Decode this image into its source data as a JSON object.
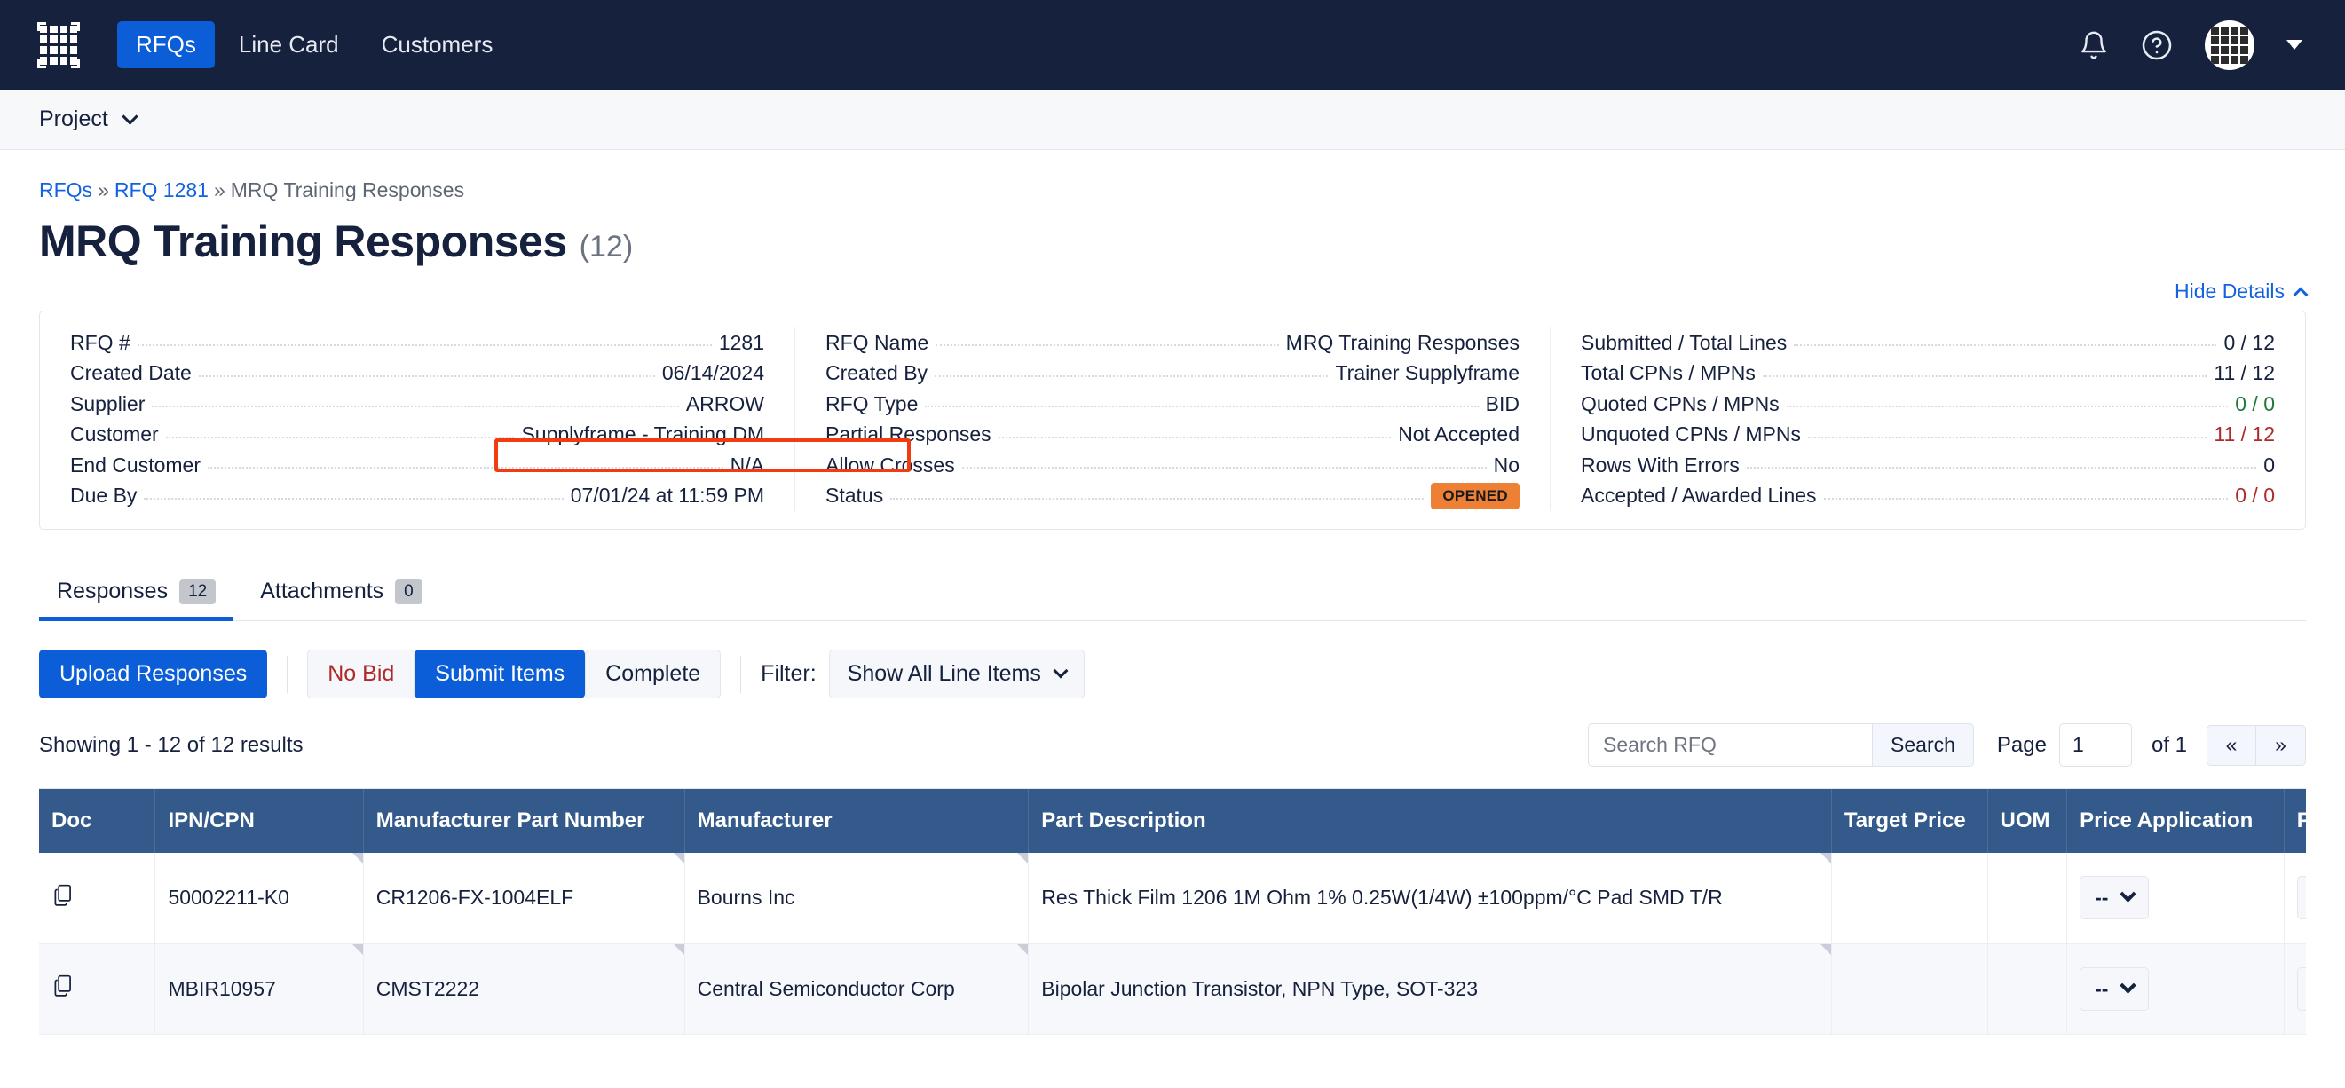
{
  "topnav": {
    "logo_icon": "grid-logo-icon",
    "items": [
      {
        "label": "RFQs",
        "active": true
      },
      {
        "label": "Line Card",
        "active": false
      },
      {
        "label": "Customers",
        "active": false
      }
    ],
    "right_icons": [
      "bell-icon",
      "help-circle-icon",
      "avatar",
      "chevron-down-icon"
    ],
    "accent_color": "#0b5ed7",
    "background_color": "#16213e"
  },
  "projectbar": {
    "label": "Project",
    "chevron": "chevron-down-icon"
  },
  "breadcrumb": {
    "item1": "RFQs",
    "sep1": "»",
    "item2": "RFQ 1281",
    "sep2": "»",
    "item3": "MRQ Training Responses"
  },
  "page_header": {
    "title": "MRQ Training Responses",
    "count": "(12)",
    "hide_details": "Hide Details"
  },
  "details": {
    "col1": [
      {
        "key": "RFQ #",
        "value": "1281"
      },
      {
        "key": "Created Date",
        "value": "06/14/2024"
      },
      {
        "key": "Supplier",
        "value": "ARROW"
      },
      {
        "key": "Customer",
        "value": "Supplyframe - Training DM"
      },
      {
        "key": "End Customer",
        "value": "N/A"
      },
      {
        "key": "Due By",
        "value": "07/01/24 at 11:59 PM"
      }
    ],
    "col2": [
      {
        "key": "RFQ Name",
        "value": "MRQ Training Responses"
      },
      {
        "key": "Created By",
        "value": "Trainer Supplyframe"
      },
      {
        "key": "RFQ Type",
        "value": "BID"
      },
      {
        "key": "Partial Responses",
        "value": "Not Accepted"
      },
      {
        "key": "Allow Crosses",
        "value": "No",
        "highlighted": true
      },
      {
        "key": "Status",
        "value": "OPENED",
        "badge": true
      }
    ],
    "col3": [
      {
        "key": "Submitted / Total Lines",
        "value": "0 / 12",
        "tone": ""
      },
      {
        "key": "Total CPNs / MPNs",
        "value": "11 / 12",
        "tone": ""
      },
      {
        "key": "Quoted CPNs / MPNs",
        "value": "0 / 0",
        "tone": "green"
      },
      {
        "key": "Unquoted CPNs / MPNs",
        "value": "11 / 12",
        "tone": "red"
      },
      {
        "key": "Rows With Errors",
        "value": "0",
        "tone": ""
      },
      {
        "key": "Accepted / Awarded Lines",
        "value": "0 / 0",
        "tone": "red"
      }
    ],
    "highlight_color": "#f03c10",
    "badge_color": "#ee8036"
  },
  "tabs": [
    {
      "label": "Responses",
      "badge": "12",
      "active": true
    },
    {
      "label": "Attachments",
      "badge": "0",
      "active": false
    }
  ],
  "toolbar": {
    "upload_label": "Upload Responses",
    "no_bid_label": "No Bid",
    "submit_items_label": "Submit Items",
    "complete_label": "Complete",
    "filter_label": "Filter:",
    "filter_value": "Show All Line Items"
  },
  "results": {
    "showing_text": "Showing 1 - 12 of 12 results",
    "search_placeholder": "Search RFQ",
    "search_value": "",
    "search_button": "Search",
    "page_label": "Page",
    "page_value": "1",
    "of_text": "of 1",
    "first_page": "«",
    "last_page": "»"
  },
  "table": {
    "columns": [
      "Doc",
      "IPN/CPN",
      "Manufacturer Part Number",
      "Manufacturer",
      "Part Description",
      "Target Price",
      "UOM",
      "Price Application",
      "Package T"
    ],
    "rows": [
      {
        "doc": "copy-document-icon",
        "ipn_cpn": "50002211-K0",
        "mpn": "CR1206-FX-1004ELF",
        "manufacturer": "Bourns Inc",
        "description": "Res Thick Film 1206 1M Ohm 1% 0.25W(1/4W) ±100ppm/°C Pad SMD T/R",
        "target_price": "",
        "uom": "",
        "price_application": "--",
        "package_type": "--"
      },
      {
        "doc": "copy-document-icon",
        "ipn_cpn": "MBIR10957",
        "mpn": "CMST2222",
        "manufacturer": "Central Semiconductor Corp",
        "description": "Bipolar Junction Transistor, NPN Type, SOT-323",
        "target_price": "",
        "uom": "",
        "price_application": "--",
        "package_type": "--"
      }
    ],
    "header_bg": "#335a8a"
  }
}
